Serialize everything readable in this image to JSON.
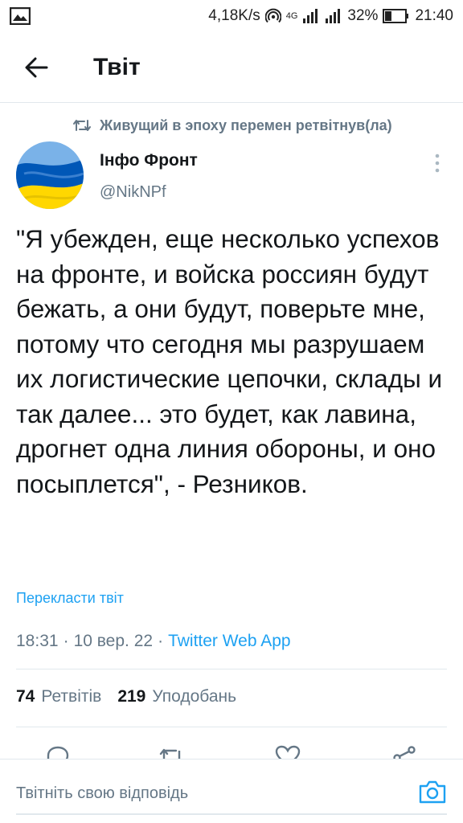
{
  "status_bar": {
    "speed": "4,18K/s",
    "network": "4G",
    "battery": "32%",
    "time": "21:40"
  },
  "header": {
    "title": "Твіт"
  },
  "retweet": {
    "text": "Живущий в эпоху перемен ретвітнув(ла)"
  },
  "author": {
    "name": "Інфо Фронт",
    "handle": "@NikNPf"
  },
  "tweet": {
    "text": "\"Я убежден, еще несколько успехов на фронте, и войска россиян будут бежать, а они будут, поверьте мне, потому что сегодня мы разрушаем их логистические цепочки, склады и так далее... это будет, как лавина, дрогнет одна линия обороны, и оно посыплется\", - Резников.",
    "translate_label": "Перекласти твіт",
    "time": "18:31",
    "date": "10 вер. 22",
    "separator": "·",
    "source": "Twitter Web App"
  },
  "stats": {
    "retweets_count": "74",
    "retweets_label": "Ретвітів",
    "likes_count": "219",
    "likes_label": "Уподобань"
  },
  "actions": [
    "reply-icon",
    "retweet-icon",
    "like-icon",
    "share-icon"
  ],
  "reply": {
    "placeholder": "Твітніть свою відповідь"
  },
  "colors": {
    "accent": "#1da1f2",
    "secondary_text": "#657786",
    "divider": "#e1e8ed",
    "flag_blue": "#0057b7",
    "flag_yellow": "#ffd700"
  }
}
